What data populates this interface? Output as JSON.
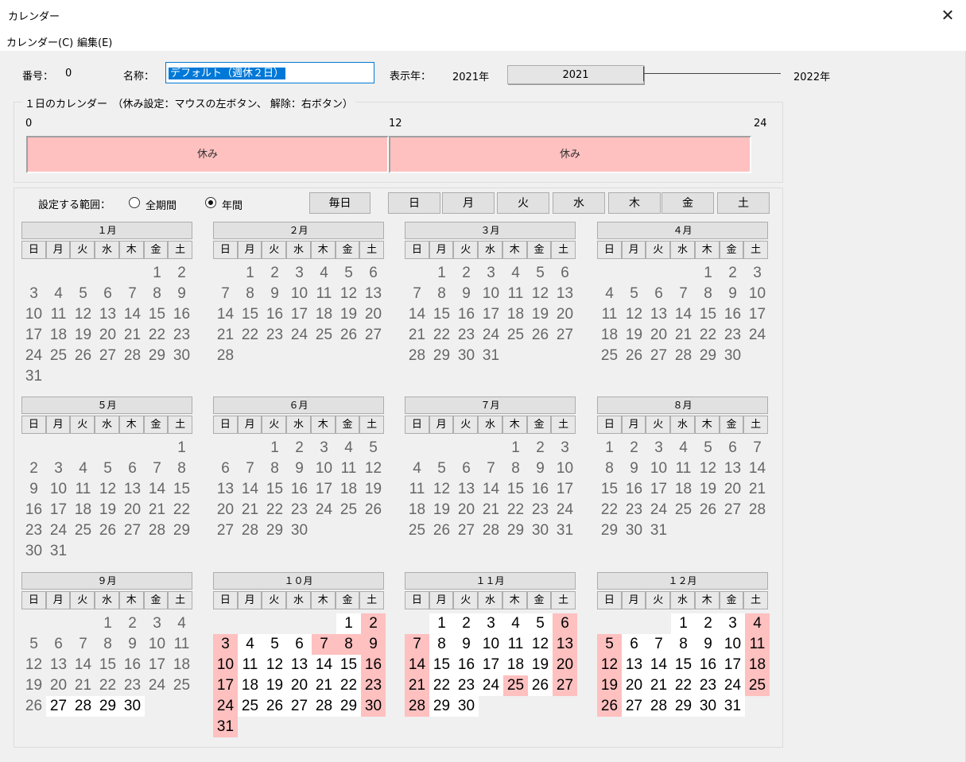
{
  "window": {
    "title": "カレンダー",
    "close": "✕"
  },
  "menu": [
    "カレンダー(C)",
    "編集(E)"
  ],
  "header": {
    "number_label": "番号：",
    "number_value": "0",
    "name_label": "名称：",
    "name_value": "デフォルト（週休２日）",
    "year_label": "表示年：",
    "year_min": "2021年",
    "year_value": "2021",
    "year_max": "2022年"
  },
  "day": {
    "caption": "１日のカレンダー　（休み設定：マウスの左ボタン、 解除：右ボタン）",
    "hours": [
      "0",
      "12",
      "24"
    ],
    "blocks": [
      "休み",
      "休み"
    ]
  },
  "range": {
    "label": "設定する範囲：",
    "options": [
      "全期間",
      "年間"
    ],
    "selected": "年間"
  },
  "buttons": {
    "everyday": "毎日",
    "weekdays": [
      "日",
      "月",
      "火",
      "水",
      "木",
      "金",
      "土"
    ]
  },
  "weekday_headers": [
    "日",
    "月",
    "火",
    "水",
    "木",
    "金",
    "土"
  ],
  "months": [
    {
      "label": "１月",
      "start": 5,
      "days": 31
    },
    {
      "label": "２月",
      "start": 1,
      "days": 28
    },
    {
      "label": "３月",
      "start": 1,
      "days": 31
    },
    {
      "label": "４月",
      "start": 4,
      "days": 30
    },
    {
      "label": "５月",
      "start": 6,
      "days": 31
    },
    {
      "label": "６月",
      "start": 2,
      "days": 30
    },
    {
      "label": "７月",
      "start": 4,
      "days": 31
    },
    {
      "label": "８月",
      "start": 0,
      "days": 31
    },
    {
      "label": "９月",
      "start": 3,
      "days": 30,
      "active_from": 27,
      "holidays": []
    },
    {
      "label": "１０月",
      "start": 5,
      "days": 31,
      "active_from": 1,
      "holidays": [
        2,
        3,
        7,
        8,
        9,
        10,
        16,
        17,
        23,
        24,
        30,
        31
      ]
    },
    {
      "label": "１１月",
      "start": 1,
      "days": 30,
      "active_from": 1,
      "holidays": [
        6,
        7,
        13,
        14,
        20,
        21,
        25,
        27,
        28
      ]
    },
    {
      "label": "１２月",
      "start": 3,
      "days": 31,
      "active_from": 1,
      "holidays": [
        4,
        5,
        11,
        12,
        18,
        19,
        25,
        26
      ]
    }
  ],
  "colors": {
    "holiday": "#ffc0c0",
    "active": "#ffffff",
    "inactive_text": "#666666"
  }
}
